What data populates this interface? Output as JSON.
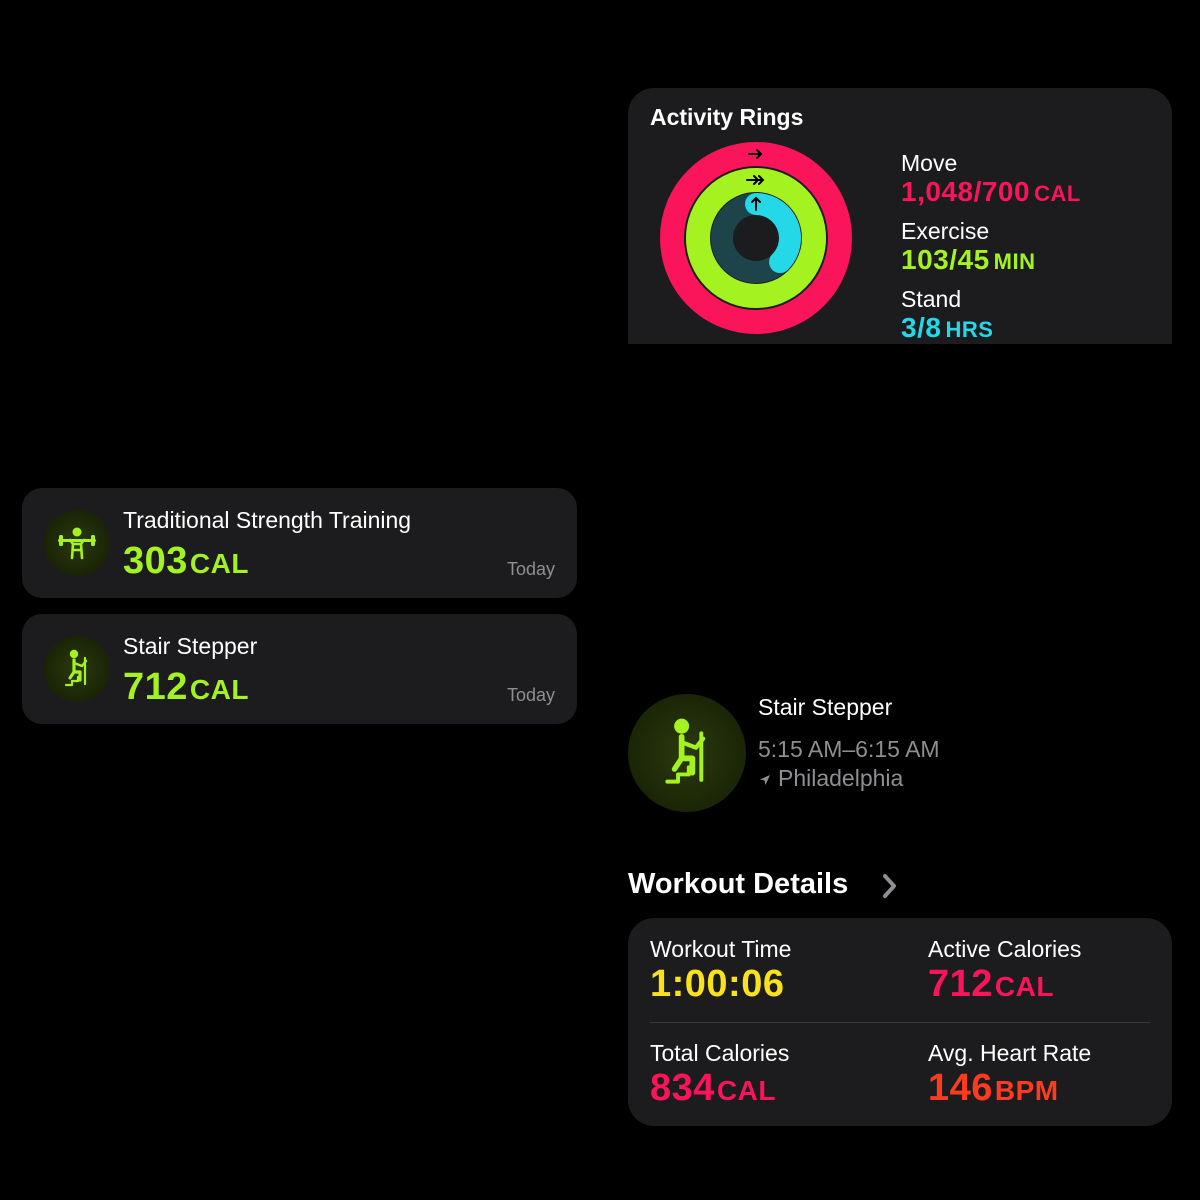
{
  "activity_rings": {
    "title": "Activity Rings",
    "move": {
      "label": "Move",
      "value": "1,048/700",
      "unit": "CAL",
      "color": "#fa1459"
    },
    "exercise": {
      "label": "Exercise",
      "value": "103/45",
      "unit": "MIN",
      "color": "#a4f321"
    },
    "stand": {
      "label": "Stand",
      "value": "3/8",
      "unit": "HRS",
      "color": "#25d8e8"
    },
    "progress": {
      "move": 1.497,
      "exercise": 2.289,
      "stand": 0.375
    }
  },
  "workouts": [
    {
      "name": "Traditional Strength Training",
      "value": "303",
      "unit": "CAL",
      "date": "Today",
      "icon": "strength-training-icon"
    },
    {
      "name": "Stair Stepper",
      "value": "712",
      "unit": "CAL",
      "date": "Today",
      "icon": "stair-stepper-icon"
    }
  ],
  "workout_header": {
    "name": "Stair Stepper",
    "time_range": "5:15 AM–6:15 AM",
    "location": "Philadelphia",
    "icon": "stair-stepper-icon"
  },
  "details": {
    "title": "Workout Details",
    "workout_time": {
      "label": "Workout Time",
      "value": "1:00:06",
      "unit": "",
      "color": "#f9e21b"
    },
    "active_calories": {
      "label": "Active Calories",
      "value": "712",
      "unit": "CAL",
      "color": "#fa1459"
    },
    "total_calories": {
      "label": "Total Calories",
      "value": "834",
      "unit": "CAL",
      "color": "#fa1459"
    },
    "avg_heart_rate": {
      "label": "Avg. Heart Rate",
      "value": "146",
      "unit": "BPM",
      "color": "#ff3b1f"
    }
  },
  "colors": {
    "background": "#000000",
    "card": "#1c1c1e",
    "secondary_text": "#8e8e93",
    "accent_green": "#a4f321"
  }
}
